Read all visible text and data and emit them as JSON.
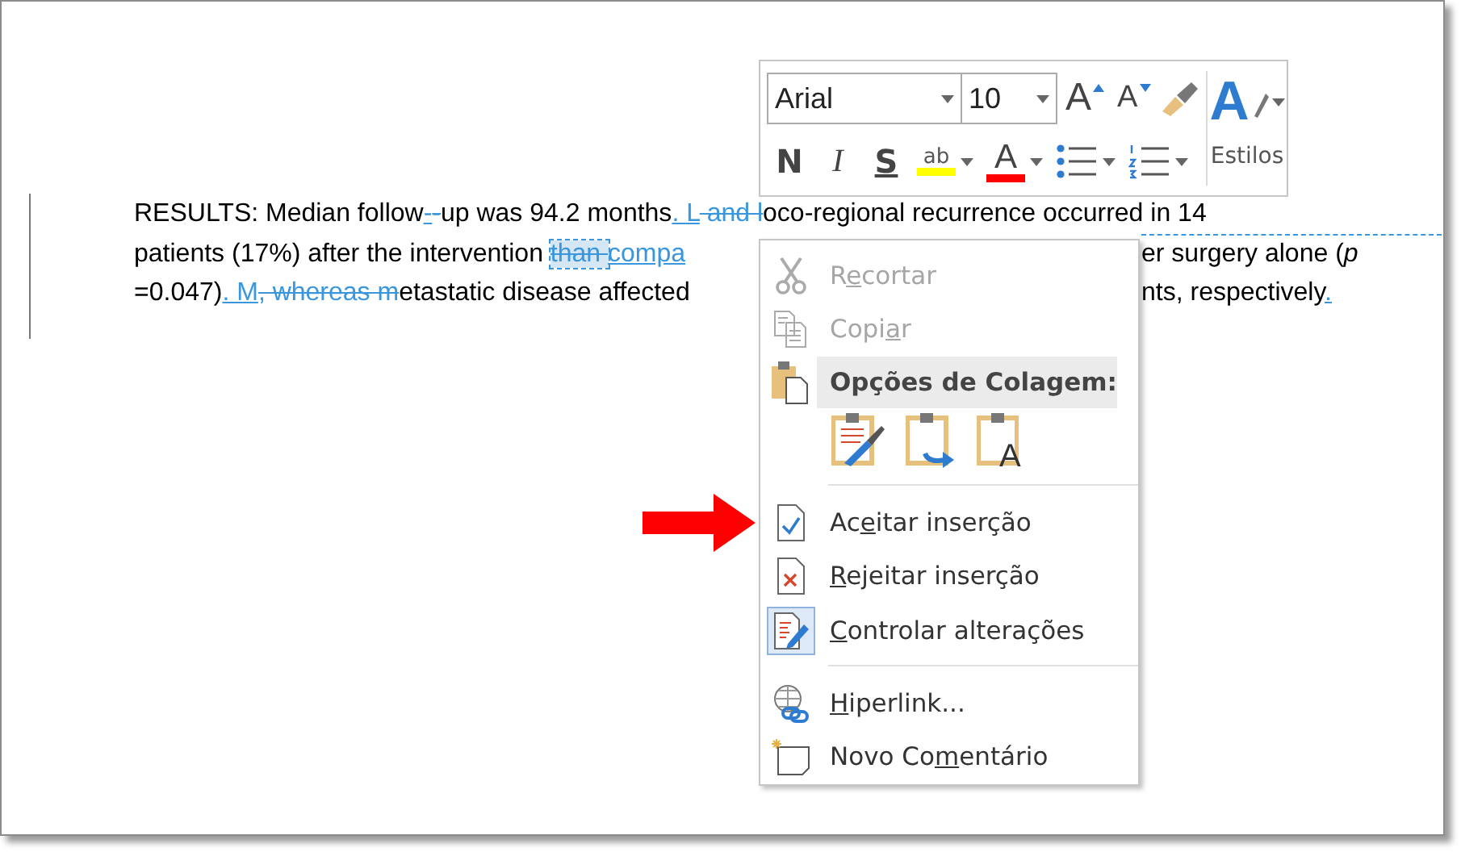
{
  "document": {
    "lines": [
      {
        "left": [
          {
            "text": "RESULTS: Median follow",
            "kind": "plain"
          },
          {
            "text": "-",
            "kind": "inserted"
          },
          {
            "text": "-",
            "kind": "deleted"
          },
          {
            "text": "up was 94.2 months",
            "kind": "plain"
          },
          {
            "text": ". L",
            "kind": "inserted"
          },
          {
            "text": " and l",
            "kind": "deleted"
          },
          {
            "text": "oco-regional recurrence occurred in 14",
            "kind": "plain"
          }
        ]
      },
      {
        "left": [
          {
            "text": "patients (17%) after the intervention ",
            "kind": "plain"
          },
          {
            "text": "than ",
            "kind": "deleted_selected"
          },
          {
            "text": "compa",
            "kind": "inserted"
          }
        ],
        "right": [
          {
            "text": "er surgery alone (",
            "kind": "plain"
          },
          {
            "text": "p",
            "kind": "italic"
          }
        ]
      },
      {
        "left": [
          {
            "text": "=0.047)",
            "kind": "plain"
          },
          {
            "text": ". M",
            "kind": "inserted"
          },
          {
            "text": ", whereas m",
            "kind": "deleted"
          },
          {
            "text": "etastatic disease affected",
            "kind": "plain"
          }
        ],
        "right": [
          {
            "text": "nts, respectively",
            "kind": "plain"
          },
          {
            "text": ".",
            "kind": "inserted"
          }
        ]
      }
    ]
  },
  "mini_toolbar": {
    "font": "Arial",
    "size": "10",
    "grow_font": "A",
    "shrink_font": "A",
    "bold": "N",
    "italic": "I",
    "underline": "S",
    "highlight": "ab",
    "font_color": "A",
    "styles_glyph": "A",
    "styles_label": "Estilos"
  },
  "context_menu": {
    "items": [
      {
        "kind": "item",
        "label": {
          "before": "R",
          "key": "e",
          "after": "cortar"
        },
        "disabled": true,
        "checked": false
      },
      {
        "kind": "item",
        "label": {
          "before": "Copi",
          "key": "a",
          "after": "r"
        },
        "disabled": true,
        "checked": false
      },
      {
        "kind": "header",
        "label": "Opções de Colagem:"
      },
      {
        "kind": "paste_options",
        "glyph": "A"
      },
      {
        "kind": "separator"
      },
      {
        "kind": "item",
        "label": {
          "before": "Ac",
          "key": "e",
          "after": "itar inserção"
        },
        "disabled": false,
        "checked": false
      },
      {
        "kind": "item",
        "label": {
          "key": "R",
          "after": "ejeitar inserção"
        },
        "disabled": false,
        "checked": false
      },
      {
        "kind": "item",
        "label": {
          "key": "C",
          "after": "ontrolar alterações"
        },
        "disabled": false,
        "checked": true
      },
      {
        "kind": "separator"
      },
      {
        "kind": "item",
        "label": {
          "key": "H",
          "after": "iperlink..."
        },
        "disabled": false,
        "checked": false
      },
      {
        "kind": "item",
        "label": {
          "before": "Novo Co",
          "key": "m",
          "after": "entário"
        },
        "disabled": false,
        "checked": false
      }
    ]
  }
}
